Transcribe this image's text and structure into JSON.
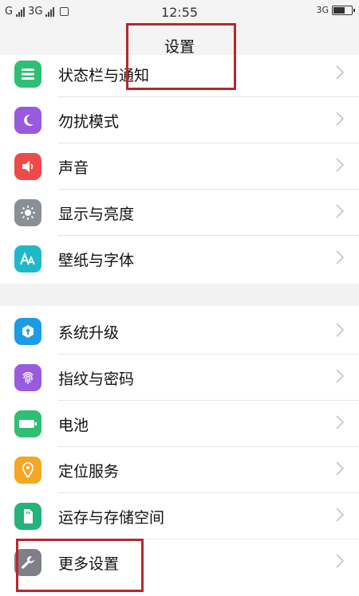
{
  "status_bar": {
    "left_g": "G",
    "left_3g": "3G",
    "time": "12:55",
    "right_network": "3G"
  },
  "header": {
    "title": "设置"
  },
  "group1": [
    {
      "label": "状态栏与通知",
      "icon": "list-icon",
      "color": "#2fbf73"
    },
    {
      "label": "勿扰模式",
      "icon": "moon-icon",
      "color": "#9a5ae0"
    },
    {
      "label": "声音",
      "icon": "speaker-icon",
      "color": "#ef4a4a"
    },
    {
      "label": "显示与亮度",
      "icon": "sun-icon",
      "color": "#8a8f96"
    },
    {
      "label": "壁纸与字体",
      "icon": "font-icon",
      "color": "#1fb8c9"
    }
  ],
  "group2": [
    {
      "label": "系统升级",
      "icon": "upgrade-icon",
      "color": "#1e9be6"
    },
    {
      "label": "指纹与密码",
      "icon": "fingerprint-icon",
      "color": "#9a5ae0"
    },
    {
      "label": "电池",
      "icon": "battery-icon",
      "color": "#2fbf73"
    },
    {
      "label": "定位服务",
      "icon": "location-icon",
      "color": "#f5a623"
    },
    {
      "label": "运存与存储空间",
      "icon": "storage-icon",
      "color": "#24b37a"
    },
    {
      "label": "更多设置",
      "icon": "wrench-icon",
      "color": "#7d8187"
    }
  ],
  "annotation_color": "#b8262c"
}
